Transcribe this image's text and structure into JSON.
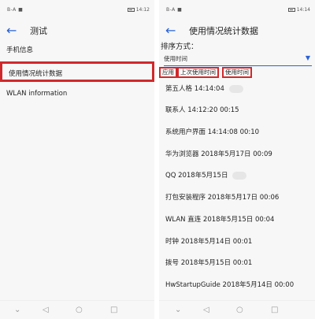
{
  "left": {
    "status": {
      "left_icons": "B-A ■",
      "time": "14:12"
    },
    "title": "测试",
    "menu": [
      {
        "label": "手机信息"
      },
      {
        "label": "使用情况统计数据",
        "highlighted": true
      },
      {
        "label": "WLAN information"
      }
    ]
  },
  "right": {
    "status": {
      "left_icons": "B-A ■",
      "time": "14:14"
    },
    "title": "使用情况统计数据",
    "sort_label": "排序方式：",
    "sort_select": {
      "value": "使用时间"
    },
    "sort_buttons": [
      "应用",
      "上次使用时间",
      "使用时间"
    ],
    "rows": [
      {
        "text": "第五人格   14:14:04",
        "blurred_tail": true
      },
      {
        "text": "联系人   14:12:20   00:15",
        "blurred_tail": false
      },
      {
        "text": "系统用户界面   14:14:08   00:10",
        "blurred_tail": false
      },
      {
        "text": "华为浏览器   2018年5月17日   00:09",
        "blurred_tail": false
      },
      {
        "text": "QQ   2018年5月15日",
        "blurred_tail": true
      },
      {
        "text": "打包安装程序   2018年5月17日   00:06",
        "blurred_tail": false
      },
      {
        "text": "WLAN 直连   2018年5月15日   00:04",
        "blurred_tail": false
      },
      {
        "text": "时钟   2018年5月14日   00:01",
        "blurred_tail": false
      },
      {
        "text": "拨号   2018年5月15日   00:01",
        "blurred_tail": false
      },
      {
        "text": "HwStartupGuide   2018年5月14日   00:00",
        "blurred_tail": false
      }
    ]
  },
  "icons": {
    "back": "arrow-left-icon",
    "dropdown": "triangle-down-icon",
    "nav": [
      "back-triangle-icon",
      "home-circle-icon",
      "recents-square-icon"
    ]
  },
  "colors": {
    "accent": "#2a62d6",
    "highlight": "#d0292b"
  }
}
